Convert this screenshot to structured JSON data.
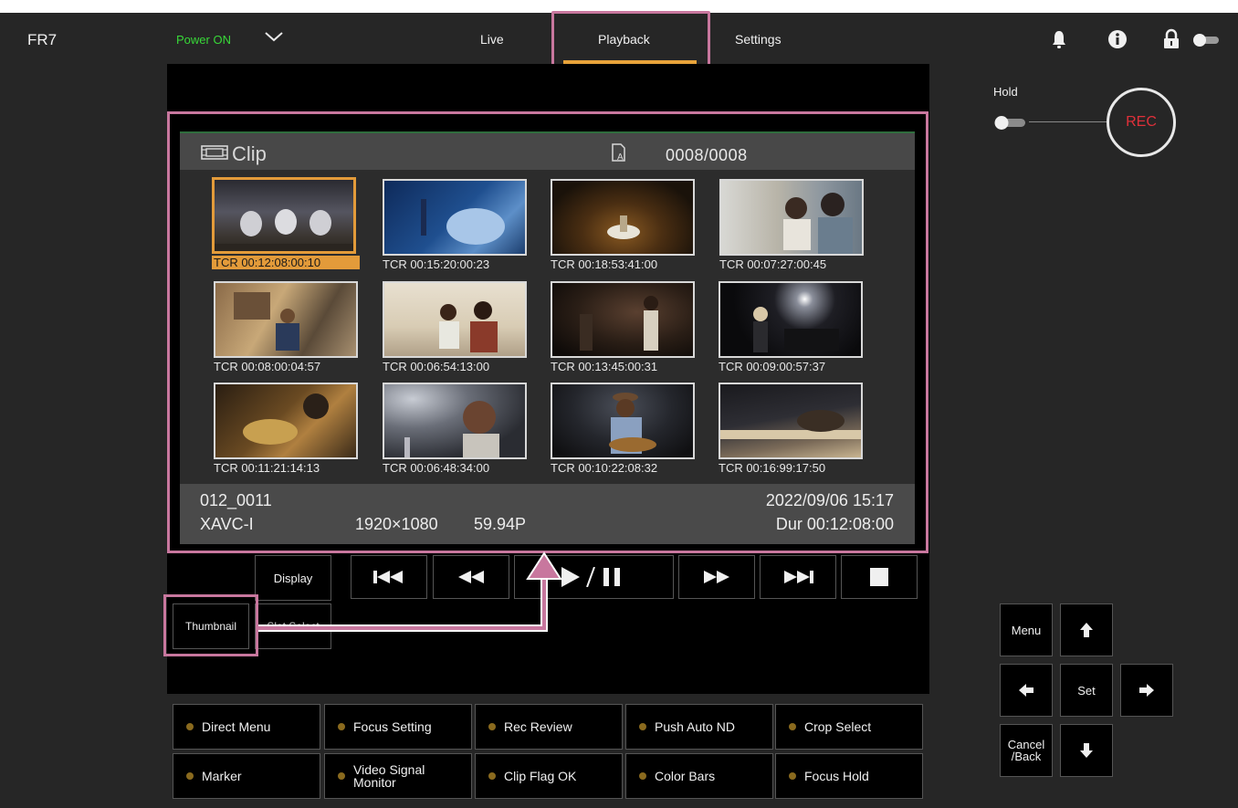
{
  "topbar": {
    "app_title": "FR7",
    "power": "Power ON",
    "tabs": {
      "live": "Live",
      "playback": "Playback",
      "settings": "Settings"
    }
  },
  "monitor": {
    "header": {
      "label": "Clip",
      "count": "0008/0008"
    },
    "thumbnails": [
      {
        "tc": "TCR 00:12:08:00:10"
      },
      {
        "tc": "TCR 00:15:20:00:23"
      },
      {
        "tc": "TCR 00:18:53:41:00"
      },
      {
        "tc": "TCR 00:07:27:00:45"
      },
      {
        "tc": "TCR 00:08:00:04:57"
      },
      {
        "tc": "TCR 00:06:54:13:00"
      },
      {
        "tc": "TCR 00:13:45:00:31"
      },
      {
        "tc": "TCR 00:09:00:57:37"
      },
      {
        "tc": "TCR 00:11:21:14:13"
      },
      {
        "tc": "TCR 00:06:48:34:00"
      },
      {
        "tc": "TCR 00:10:22:08:32"
      },
      {
        "tc": "TCR 00:16:99:17:50"
      }
    ],
    "footer": {
      "clip_name": "012_0011",
      "codec": "XAVC-I",
      "resolution": "1920×1080",
      "framerate": "59.94P",
      "datetime": "2022/09/06 15:17",
      "duration": "Dur 00:12:08:00"
    }
  },
  "controls": {
    "display": "Display",
    "thumbnail": "Thumbnail",
    "slot_select": "Slot Select"
  },
  "right": {
    "hold": "Hold",
    "rec": "REC",
    "menu": "Menu",
    "set": "Set",
    "cancel": "Cancel /Back"
  },
  "assign": {
    "direct_menu": "Direct Menu",
    "focus_setting": "Focus Setting",
    "rec_review": "Rec Review",
    "push_auto_nd": "Push Auto ND",
    "crop_select": "Crop Select",
    "marker": "Marker",
    "video_signal_monitor_1": "Video Signal",
    "video_signal_monitor_2": "Monitor",
    "clip_flag_ok": "Clip Flag OK",
    "color_bars": "Color Bars",
    "focus_hold": "Focus Hold"
  },
  "colors": {
    "accent": "#e8a33a",
    "highlight": "#c8779e",
    "power_on": "#38d838",
    "rec": "#e0303a"
  },
  "icons": [
    "chevron-down-icon",
    "bell-icon",
    "info-icon",
    "lock-icon",
    "toggle-icon",
    "film-icon",
    "media-card-icon",
    "skip-previous-icon",
    "rewind-icon",
    "play-pause-icon",
    "fast-forward-icon",
    "skip-next-icon",
    "stop-icon",
    "arrow-up-icon",
    "arrow-left-icon",
    "arrow-right-icon",
    "arrow-down-icon"
  ]
}
